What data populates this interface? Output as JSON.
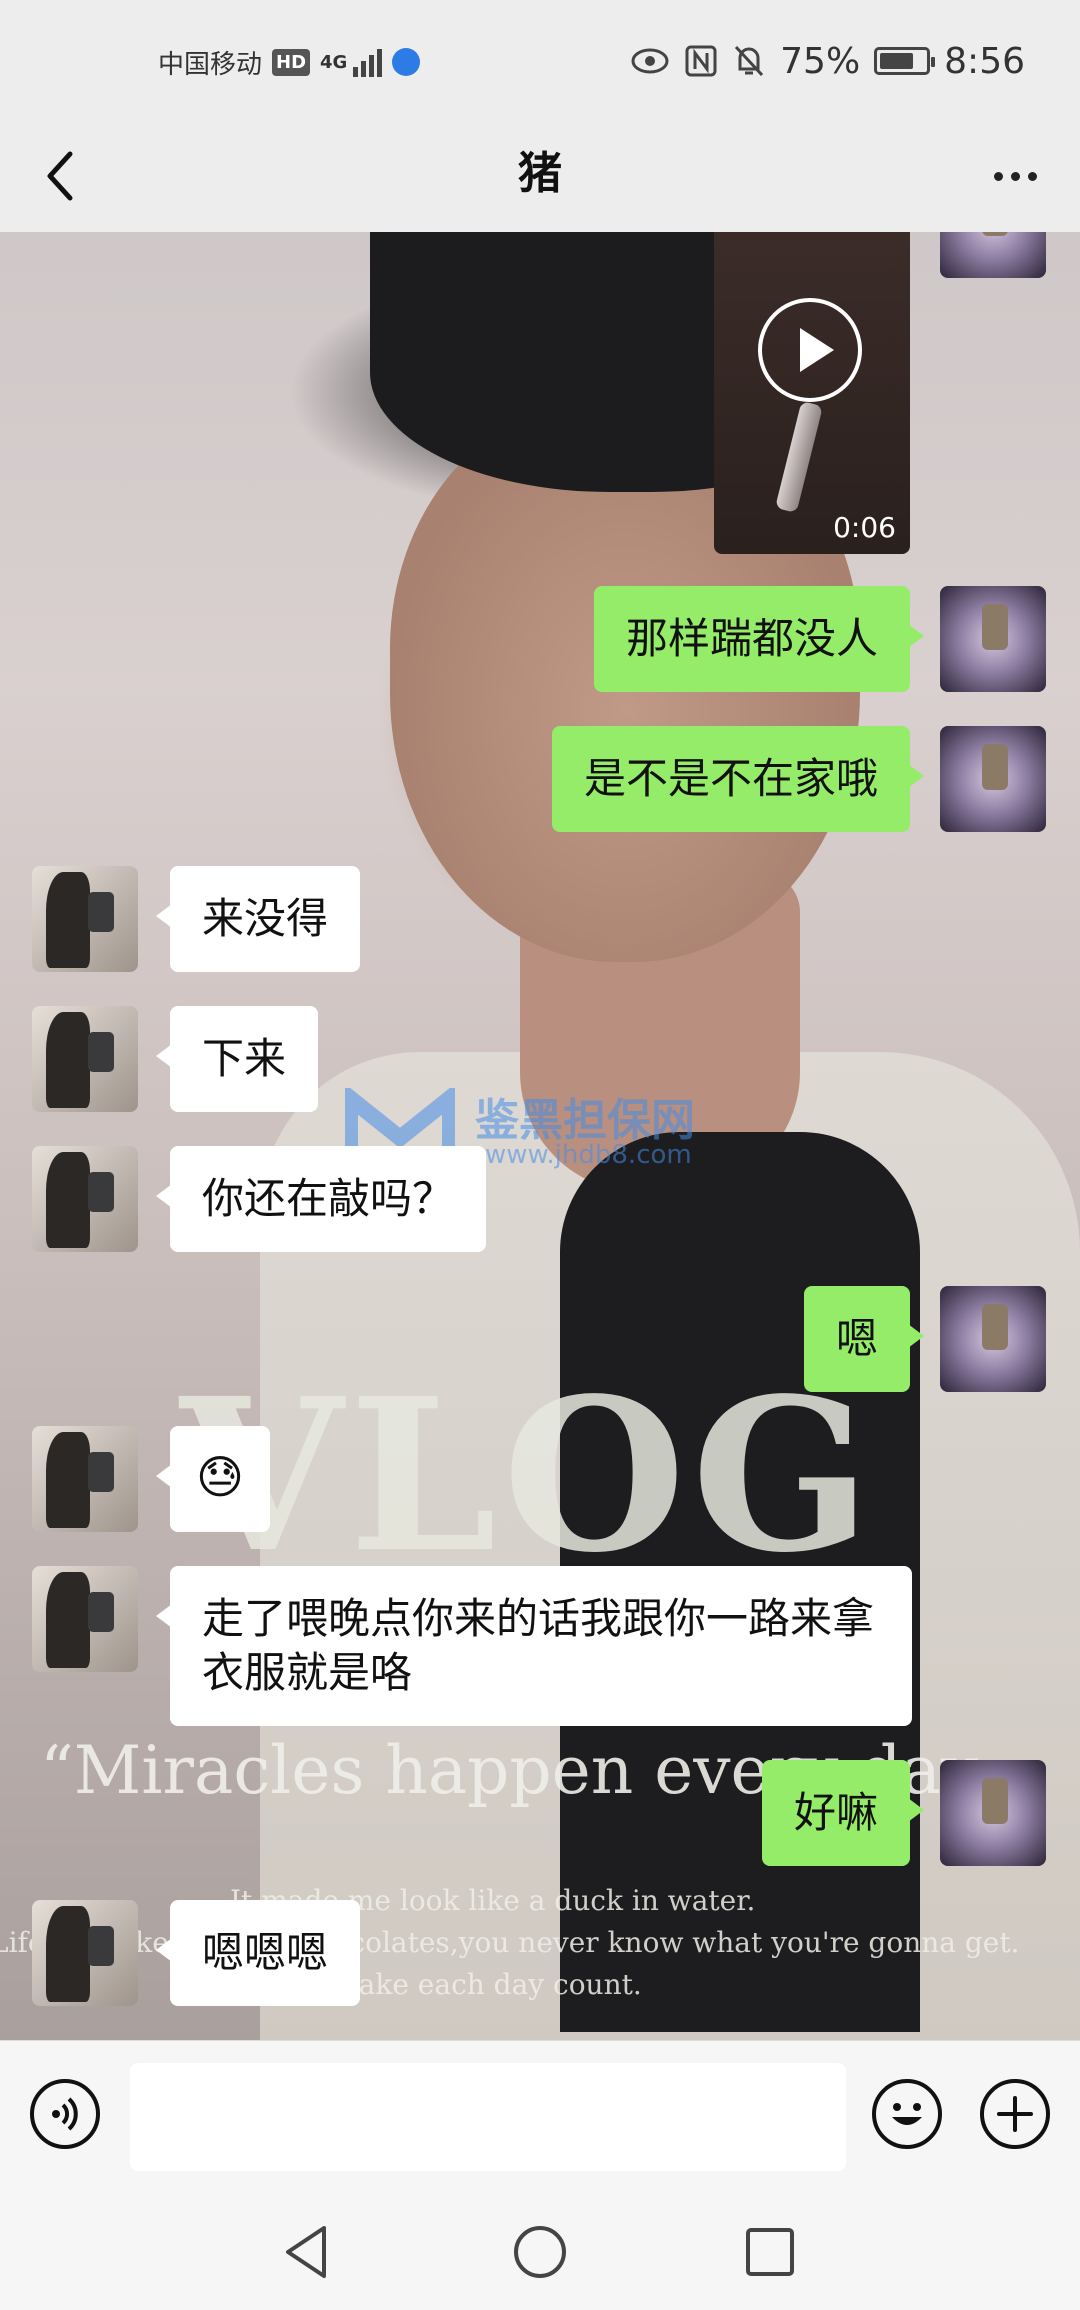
{
  "status_bar": {
    "carrier": "中国移动",
    "hd": "HD",
    "network": "4G",
    "battery": "75%",
    "battery_level": 0.75,
    "time": "8:56"
  },
  "header": {
    "title": "猪"
  },
  "background": {
    "vlog_text": "VLOG",
    "quote": "“Miracles happen every day.",
    "lines": [
      "It made me look like a duck in water.",
      "Life was like a box of chocolates,you never know what you're gonna get.",
      "Make each day count."
    ],
    "watermark_title": "鉴黑担保网",
    "watermark_url": "www.jhdb8.com"
  },
  "messages": [
    {
      "sender": "me",
      "type": "video",
      "duration": "0:06"
    },
    {
      "sender": "me",
      "type": "text",
      "text": "那样踹都没人"
    },
    {
      "sender": "me",
      "type": "text",
      "text": "是不是不在家哦"
    },
    {
      "sender": "them",
      "type": "text",
      "text": "来没得"
    },
    {
      "sender": "them",
      "type": "text",
      "text": "下来"
    },
    {
      "sender": "them",
      "type": "text",
      "text": "你还在敲吗？"
    },
    {
      "sender": "me",
      "type": "text",
      "text": "嗯"
    },
    {
      "sender": "them",
      "type": "emoji",
      "text": "😓"
    },
    {
      "sender": "them",
      "type": "text",
      "text": "走了喂晚点你来的话我跟你一路来拿衣服就是咯"
    },
    {
      "sender": "me",
      "type": "text",
      "text": "好嘛"
    },
    {
      "sender": "them",
      "type": "text",
      "text": "嗯嗯嗯"
    }
  ],
  "input": {
    "placeholder": ""
  }
}
